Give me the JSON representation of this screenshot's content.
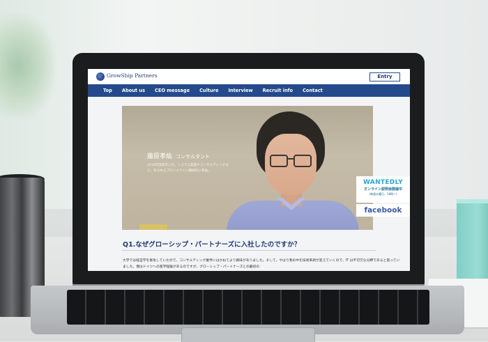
{
  "site": {
    "logo_text": "GrowShip Partners",
    "entry_label": "Entry"
  },
  "nav": {
    "items": [
      "Top",
      "About us",
      "CEO message",
      "Culture",
      "Interview",
      "Recruit info",
      "Contact"
    ]
  },
  "hero": {
    "name": "藤原孝紘",
    "role": "コンサルタント",
    "description": "2018年度新卒入社。システム開発やコンサルティングなど、あらゆるプロジェクトに積極的に参画。"
  },
  "banners": {
    "wantedly_logo": "WANTEDLY",
    "wantedly_sub": "オンライン説明会開催中",
    "wantedly_note": "(毎週水曜日、18時〜)",
    "facebook_label": "facebook"
  },
  "article": {
    "question": "Q1.なぜグローシップ・パートナーズに入社したのですか？",
    "answer": "大学では経営学を専攻していたので、コンサルティング業界にはかねてより興味がありました。そして、やはり我の中を技術革新が変えていくので、IT は不可欠な分野であると思っていました。僕はドイツへの留学経験があるのですが、グローシップ・パートナーズとの最初の"
  },
  "colors": {
    "nav_bg": "#244a8c",
    "brand": "#1f3a72",
    "wantedly": "#21a7d6",
    "facebook": "#3b5ba0"
  }
}
